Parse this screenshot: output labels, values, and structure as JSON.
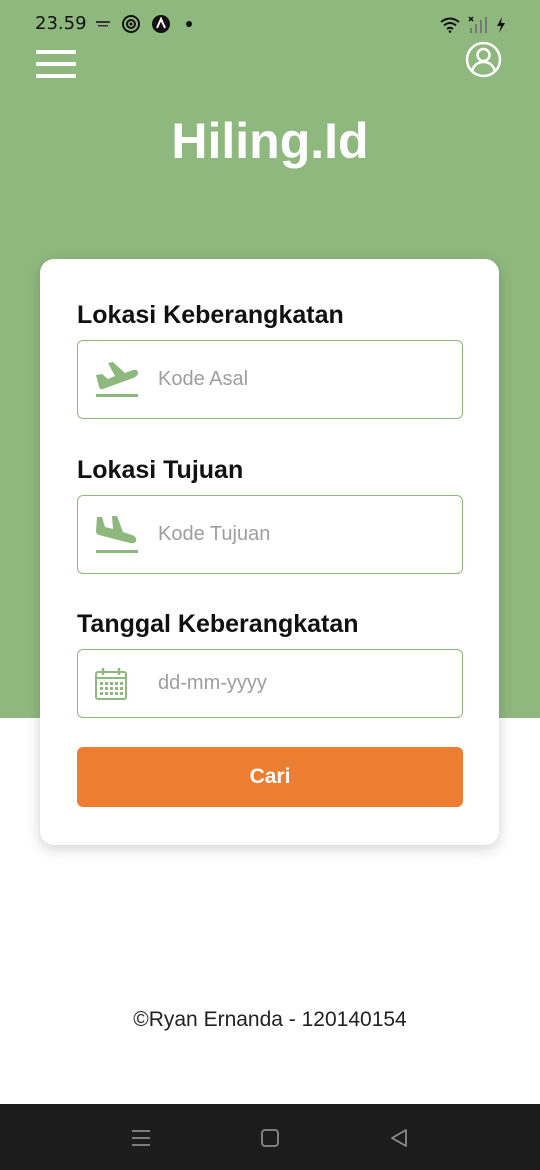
{
  "status_bar": {
    "time": "23.59",
    "icons_left": [
      "tiny-app-icon",
      "record-icon",
      "app-a-icon",
      "dot-icon"
    ],
    "icons_right": [
      "wifi-icon",
      "signal-icon",
      "charging-icon"
    ]
  },
  "header": {
    "brand": "Hiling.Id",
    "menu_icon": "hamburger-menu-icon",
    "profile_icon": "user-profile-icon",
    "background_color": "#8fb87e"
  },
  "form": {
    "departure": {
      "label": "Lokasi Keberangkatan",
      "placeholder": "Kode Asal",
      "value": "",
      "icon": "flight-takeoff-icon"
    },
    "destination": {
      "label": "Lokasi Tujuan",
      "placeholder": "Kode Tujuan",
      "value": "",
      "icon": "flight-land-icon"
    },
    "date": {
      "label": "Tanggal Keberangkatan",
      "placeholder": "dd-mm-yyyy",
      "value": "",
      "icon": "calendar-icon"
    },
    "search_button": "Cari",
    "button_color": "#ed7d31"
  },
  "footer": {
    "credit": "©Ryan Ernanda - 120140154"
  },
  "navigation_bar": {
    "buttons": [
      "recent-apps-icon",
      "home-icon",
      "back-icon"
    ]
  }
}
